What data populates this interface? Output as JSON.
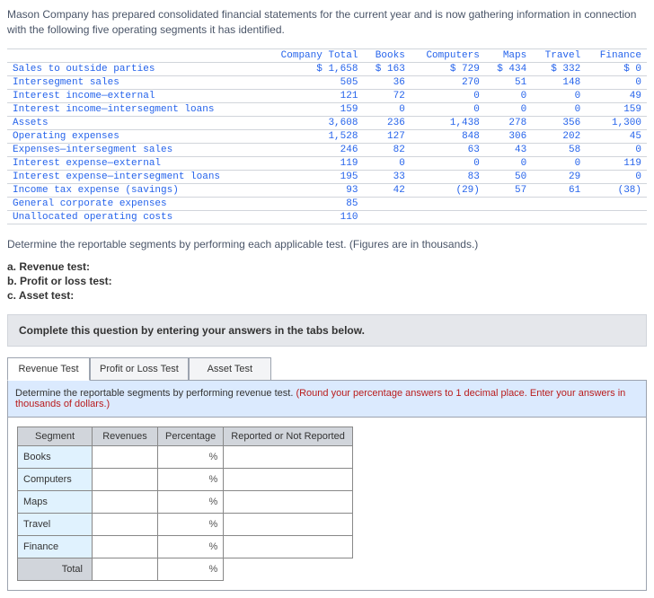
{
  "problem": {
    "intro": "Mason Company has prepared consolidated financial statements for the current year and is now gathering information in connection with the following five operating segments it has identified."
  },
  "table": {
    "col_headers": [
      "",
      "Company Total",
      "Books",
      "Computers",
      "Maps",
      "Travel",
      "Finance"
    ],
    "rows": [
      {
        "label": "Sales to outside parties",
        "vals": [
          "$ 1,658",
          "$ 163",
          "$  729",
          "$ 434",
          "$ 332",
          "$    0"
        ]
      },
      {
        "label": "Intersegment sales",
        "vals": [
          "505",
          "36",
          "270",
          "51",
          "148",
          "0"
        ]
      },
      {
        "label": "Interest income—external",
        "vals": [
          "121",
          "72",
          "0",
          "0",
          "0",
          "49"
        ]
      },
      {
        "label": "Interest income—intersegment loans",
        "vals": [
          "159",
          "0",
          "0",
          "0",
          "0",
          "159"
        ]
      },
      {
        "label": "Assets",
        "vals": [
          "3,608",
          "236",
          "1,438",
          "278",
          "356",
          "1,300"
        ]
      },
      {
        "label": "Operating expenses",
        "vals": [
          "1,528",
          "127",
          "848",
          "306",
          "202",
          "45"
        ]
      },
      {
        "label": "Expenses—intersegment sales",
        "vals": [
          "246",
          "82",
          "63",
          "43",
          "58",
          "0"
        ]
      },
      {
        "label": "Interest expense—external",
        "vals": [
          "119",
          "0",
          "0",
          "0",
          "0",
          "119"
        ]
      },
      {
        "label": "Interest expense—intersegment loans",
        "vals": [
          "195",
          "33",
          "83",
          "50",
          "29",
          "0"
        ]
      },
      {
        "label": "Income tax expense (savings)",
        "vals": [
          "93",
          "42",
          "(29)",
          "57",
          "61",
          "(38)"
        ]
      },
      {
        "label": "General corporate expenses",
        "vals": [
          "85",
          "",
          "",
          "",
          "",
          ""
        ]
      },
      {
        "label": "Unallocated operating costs",
        "vals": [
          "110",
          "",
          "",
          "",
          "",
          ""
        ]
      }
    ]
  },
  "determine_text": "Determine the reportable segments by performing each applicable test. (Figures are in thousands.)",
  "parts": {
    "a": "a. Revenue test:",
    "b": "b. Profit or loss test:",
    "c": "c. Asset test:"
  },
  "complete_instruction": "Complete this question by entering your answers in the tabs below.",
  "tabs": {
    "revenue": "Revenue Test",
    "profit": "Profit or Loss Test",
    "asset": "Asset Test"
  },
  "panel": {
    "instruction_plain": "Determine the reportable segments by performing revenue test. ",
    "instruction_red": "(Round your percentage answers to 1 decimal place. Enter your answers in thousands of dollars.)",
    "headers": {
      "segment": "Segment",
      "revenues": "Revenues",
      "percentage": "Percentage",
      "reported": "Reported or Not Reported"
    },
    "segments": [
      "Books",
      "Computers",
      "Maps",
      "Travel",
      "Finance"
    ],
    "total_label": "Total"
  }
}
